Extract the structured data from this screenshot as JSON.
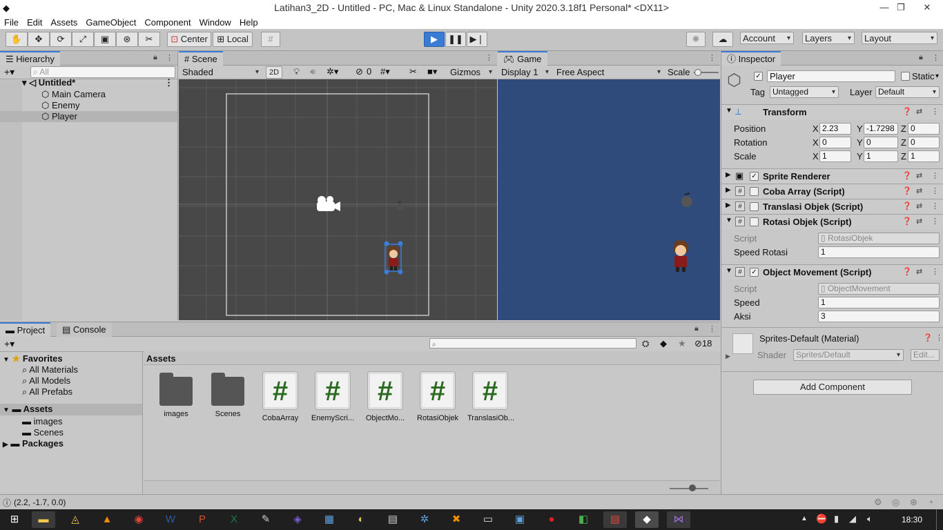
{
  "window": {
    "title": "Latihan3_2D - Untitled - PC, Mac & Linux Standalone - Unity 2020.3.18f1 Personal* <DX11>",
    "minimize": "—",
    "maximize": "❐",
    "close": "✕"
  },
  "menu": [
    "File",
    "Edit",
    "Assets",
    "GameObject",
    "Component",
    "Window",
    "Help"
  ],
  "toolbar": {
    "pivot": "Center",
    "space": "Local",
    "account": "Account",
    "layers": "Layers",
    "layout": "Layout"
  },
  "hierarchy": {
    "tab": "Hierarchy",
    "search_placeholder": "All",
    "scene": "Untitled*",
    "items": [
      "Main Camera",
      "Enemy",
      "Player"
    ]
  },
  "scene": {
    "tab": "Scene",
    "shading": "Shaded",
    "mode2d": "2D",
    "hidden": "0",
    "gizmos": "Gizmos"
  },
  "game": {
    "tab": "Game",
    "display": "Display 1",
    "aspect": "Free Aspect",
    "scale": "Scale"
  },
  "inspector": {
    "tab": "Inspector",
    "object_name": "Player",
    "static": "Static",
    "tag_label": "Tag",
    "tag": "Untagged",
    "layer_label": "Layer",
    "layer": "Default",
    "transform": {
      "title": "Transform",
      "position": {
        "label": "Position",
        "x": "2.23",
        "y": "-1.7298",
        "z": "0"
      },
      "rotation": {
        "label": "Rotation",
        "x": "0",
        "y": "0",
        "z": "0"
      },
      "scale": {
        "label": "Scale",
        "x": "1",
        "y": "1",
        "z": "1"
      }
    },
    "components": [
      "Sprite Renderer",
      "Coba Array (Script)",
      "Translasi Objek (Script)",
      "Rotasi Objek (Script)"
    ],
    "rotasi": {
      "script_label": "Script",
      "script": "RotasiObjek",
      "speed_label": "Speed Rotasi",
      "speed": "1"
    },
    "movement": {
      "title": "Object Movement (Script)",
      "script_label": "Script",
      "script": "ObjectMovement",
      "speed_label": "Speed",
      "speed": "1",
      "aksi_label": "Aksi",
      "aksi": "3"
    },
    "material": {
      "title": "Sprites-Default (Material)",
      "shader_label": "Shader",
      "shader": "Sprites/Default",
      "edit": "Edit..."
    },
    "add_component": "Add Component"
  },
  "project": {
    "tab": "Project",
    "console_tab": "Console",
    "hidden_count": "18",
    "favorites": "Favorites",
    "fav_items": [
      "All Materials",
      "All Models",
      "All Prefabs"
    ],
    "assets_root": "Assets",
    "asset_folders": [
      "images",
      "Scenes"
    ],
    "packages": "Packages",
    "breadcrumb": "Assets",
    "assets": [
      {
        "name": "images",
        "kind": "folder"
      },
      {
        "name": "Scenes",
        "kind": "folder"
      },
      {
        "name": "CobaArray",
        "kind": "script"
      },
      {
        "name": "EnemyScri...",
        "kind": "script"
      },
      {
        "name": "ObjectMo...",
        "kind": "script"
      },
      {
        "name": "RotasiObjek",
        "kind": "script"
      },
      {
        "name": "TranslasiOb...",
        "kind": "script"
      }
    ]
  },
  "status": {
    "text": "(2.2, -1.7, 0.0)"
  },
  "taskbar": {
    "clock": "18:30"
  },
  "colors": {
    "accent": "#3a7bd5",
    "game_bg": "#2f4b7b",
    "scene_bg": "#484848"
  }
}
